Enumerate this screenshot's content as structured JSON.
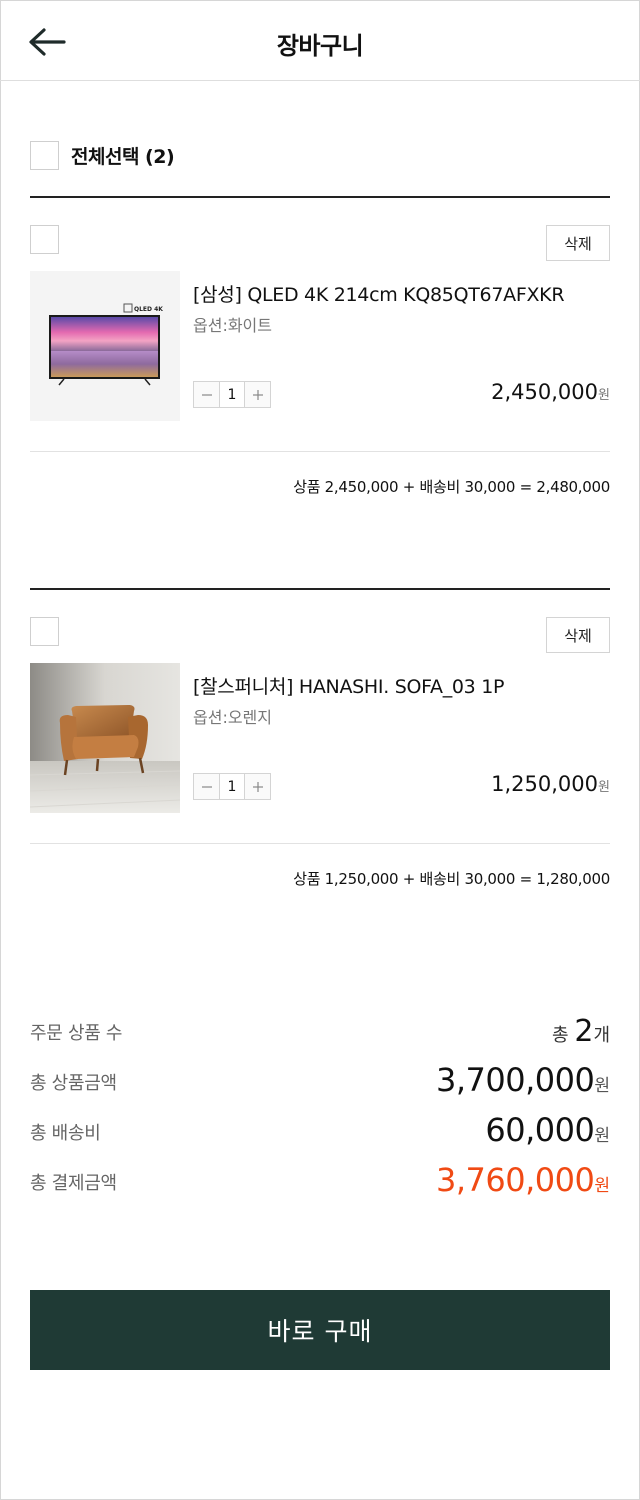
{
  "header": {
    "title": "장바구니",
    "back_icon": "arrow-left-icon"
  },
  "select_all": {
    "label": "전체선택 (2)",
    "checked": false
  },
  "items": [
    {
      "checked": false,
      "delete_label": "삭제",
      "name": "[삼성] QLED 4K 214cm KQ85QT67AFXKR",
      "option": "옵션:화이트",
      "quantity": "1",
      "price": "2,450,000",
      "price_unit": "원",
      "summary": "상품 2,450,000 + 배송비 30,000 = 2,480,000",
      "image": "tv-product-image",
      "tv_badge": "QLED 4K"
    },
    {
      "checked": false,
      "delete_label": "삭제",
      "name": "[찰스퍼니처] HANASHI. SOFA_03 1P",
      "option": "옵션:오렌지",
      "quantity": "1",
      "price": "1,250,000",
      "price_unit": "원",
      "summary": "상품 1,250,000 + 배송비 30,000 = 1,280,000",
      "image": "sofa-product-image"
    }
  ],
  "totals": {
    "count": {
      "label": "주문 상품 수",
      "prefix": "총 ",
      "value": "2",
      "unit": "개"
    },
    "products": {
      "label": "총 상품금액",
      "value": "3,700,000",
      "unit": "원"
    },
    "shipping": {
      "label": "총 배송비",
      "value": "60,000",
      "unit": "원"
    },
    "payment": {
      "label": "총 결제금액",
      "value": "3,760,000",
      "unit": "원"
    }
  },
  "buy_button": {
    "label": "바로 구매"
  },
  "colors": {
    "accent": "#f04a14",
    "button": "#1f3a35"
  }
}
